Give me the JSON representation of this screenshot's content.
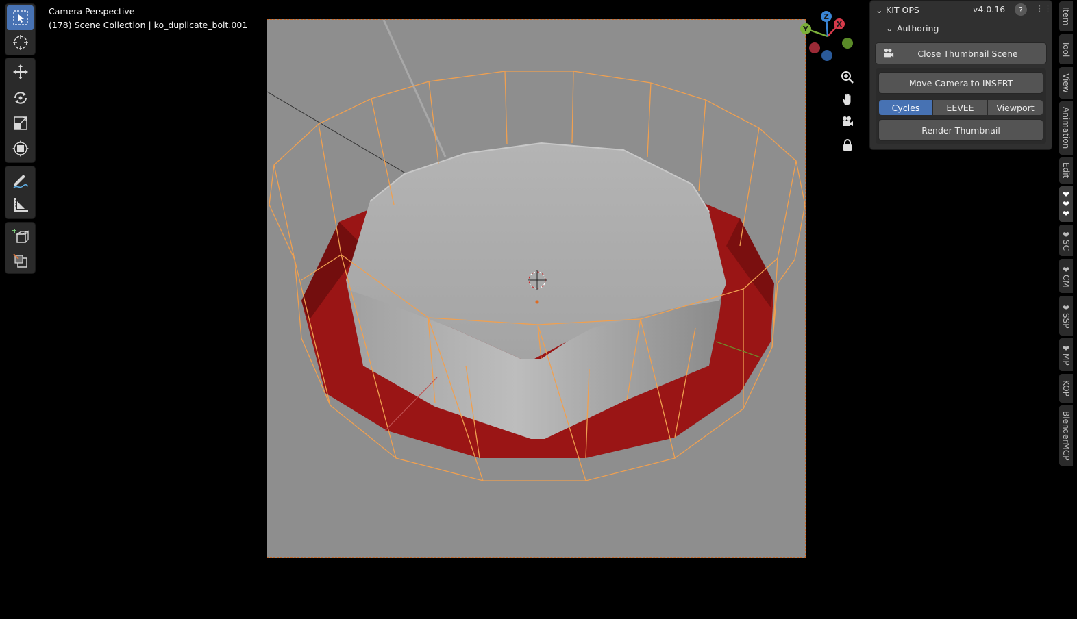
{
  "viewport": {
    "view_name": "Camera Perspective",
    "frame_info": "(178) Scene Collection | ko_duplicate_bolt.001"
  },
  "toolbar": {
    "tools": [
      {
        "name": "select-box",
        "icon": "select-box-icon",
        "active": true
      },
      {
        "name": "cursor",
        "icon": "cursor-icon"
      },
      {
        "name": "move",
        "icon": "move-icon"
      },
      {
        "name": "rotate",
        "icon": "rotate-icon"
      },
      {
        "name": "scale",
        "icon": "scale-icon"
      },
      {
        "name": "transform",
        "icon": "transform-icon"
      },
      {
        "name": "annotate",
        "icon": "annotate-icon"
      },
      {
        "name": "measure",
        "icon": "measure-icon"
      },
      {
        "name": "add-cube",
        "icon": "add-cube-icon"
      },
      {
        "name": "extrude",
        "icon": "extrude-icon"
      }
    ]
  },
  "gizmo": {
    "x_label": "X",
    "y_label": "Y",
    "z_label": "Z",
    "x_color": "#d63a4a",
    "y_color": "#7bb03a",
    "z_color": "#3a86d6"
  },
  "nav_buttons": [
    "zoom-icon",
    "pan-hand-icon",
    "camera-icon",
    "lock-icon"
  ],
  "panel": {
    "title": "KIT OPS",
    "version": "v4.0.16",
    "help": "?",
    "subpanel": "Authoring",
    "close_thumbnail": "Close Thumbnail Scene",
    "move_camera": "Move Camera to INSERT",
    "render_engines": [
      "Cycles",
      "EEVEE",
      "Viewport"
    ],
    "active_engine": "Cycles",
    "render_thumbnail": "Render Thumbnail"
  },
  "side_tabs": [
    "Item",
    "Tool",
    "View",
    "Animation",
    "Edit",
    "❤❤❤",
    "❤SC",
    "❤CM",
    "❤SSP",
    "❤MP",
    "KOP",
    "BlenderMCP"
  ],
  "colors": {
    "accent": "#4772b3",
    "selection_wire": "#f0a050",
    "boolean_red": "#9a1515"
  }
}
